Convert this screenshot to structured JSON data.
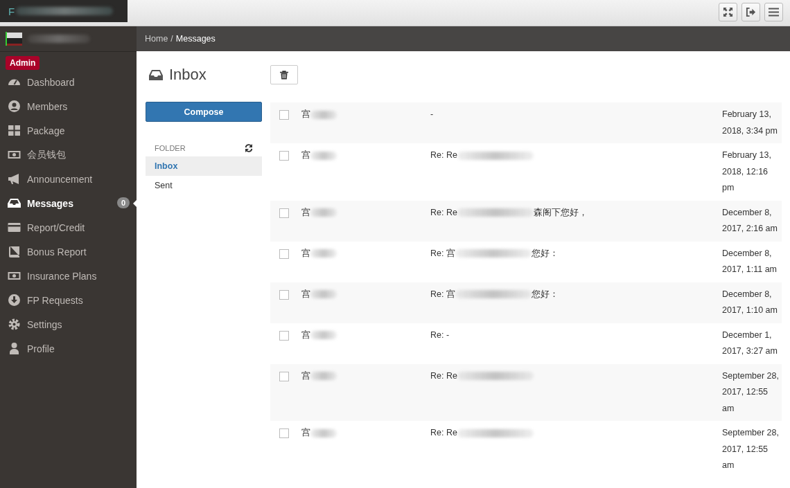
{
  "top_bar": {
    "title_initial": "F",
    "title_redacted": true
  },
  "sidebar": {
    "brand_redacted": true,
    "role_badge": "Admin",
    "items": [
      {
        "label": "Dashboard",
        "selected": false
      },
      {
        "label": "Members",
        "selected": false
      },
      {
        "label": "Package",
        "selected": false
      },
      {
        "label": "会员钱包",
        "selected": false
      },
      {
        "label": "Announcement",
        "selected": false
      },
      {
        "label": "Messages",
        "selected": true,
        "badge": "0"
      },
      {
        "label": "Report/Credit",
        "selected": false
      },
      {
        "label": "Bonus Report",
        "selected": false
      },
      {
        "label": "Insurance Plans",
        "selected": false
      },
      {
        "label": "FP Requests",
        "selected": false
      },
      {
        "label": "Settings",
        "selected": false
      },
      {
        "label": "Profile",
        "selected": false
      }
    ]
  },
  "breadcrumb": {
    "items": [
      "Home",
      "Messages"
    ],
    "separator": "/"
  },
  "page_title": "Inbox",
  "compose_button": "Compose",
  "folder_label": "FOLDER",
  "folders": [
    {
      "label": "Inbox",
      "selected": true
    },
    {
      "label": "Sent",
      "selected": false
    }
  ],
  "messages": [
    {
      "checked": false,
      "sender": "宫",
      "sender_redacted": true,
      "subject": "-",
      "subject_redacted": false,
      "date": "February 13, 2018, 3:34 pm"
    },
    {
      "checked": false,
      "sender": "宫",
      "sender_redacted": true,
      "subject": "Re: Re",
      "subject_redacted": true,
      "date": "February 13, 2018, 12:16 pm"
    },
    {
      "checked": false,
      "sender": "宫",
      "sender_redacted": true,
      "subject": "Re: Re",
      "subject_redacted": true,
      "subject_end": "森阁下您好，",
      "date": "December 8, 2017, 2:16 am"
    },
    {
      "checked": false,
      "sender": "宫",
      "sender_redacted": true,
      "subject": "Re: 宫",
      "subject_redacted": true,
      "subject_end": "您好：",
      "date": "December 8, 2017, 1:11 am"
    },
    {
      "checked": false,
      "sender": "宫",
      "sender_redacted": true,
      "subject": "Re: 宫",
      "subject_redacted": true,
      "subject_end": "您好：",
      "date": "December 8, 2017, 1:10 am"
    },
    {
      "checked": false,
      "sender": "宫",
      "sender_redacted": true,
      "subject": "Re: -",
      "subject_redacted": false,
      "date": "December 1, 2017, 3:27 am"
    },
    {
      "checked": false,
      "sender": "宫",
      "sender_redacted": true,
      "subject": "Re: Re",
      "subject_redacted": true,
      "date": "September 28, 2017, 12:55 am"
    },
    {
      "checked": false,
      "sender": "宫",
      "sender_redacted": true,
      "subject": "Re: Re",
      "subject_redacted": true,
      "date": "September 28, 2017, 12:55 am"
    }
  ]
}
